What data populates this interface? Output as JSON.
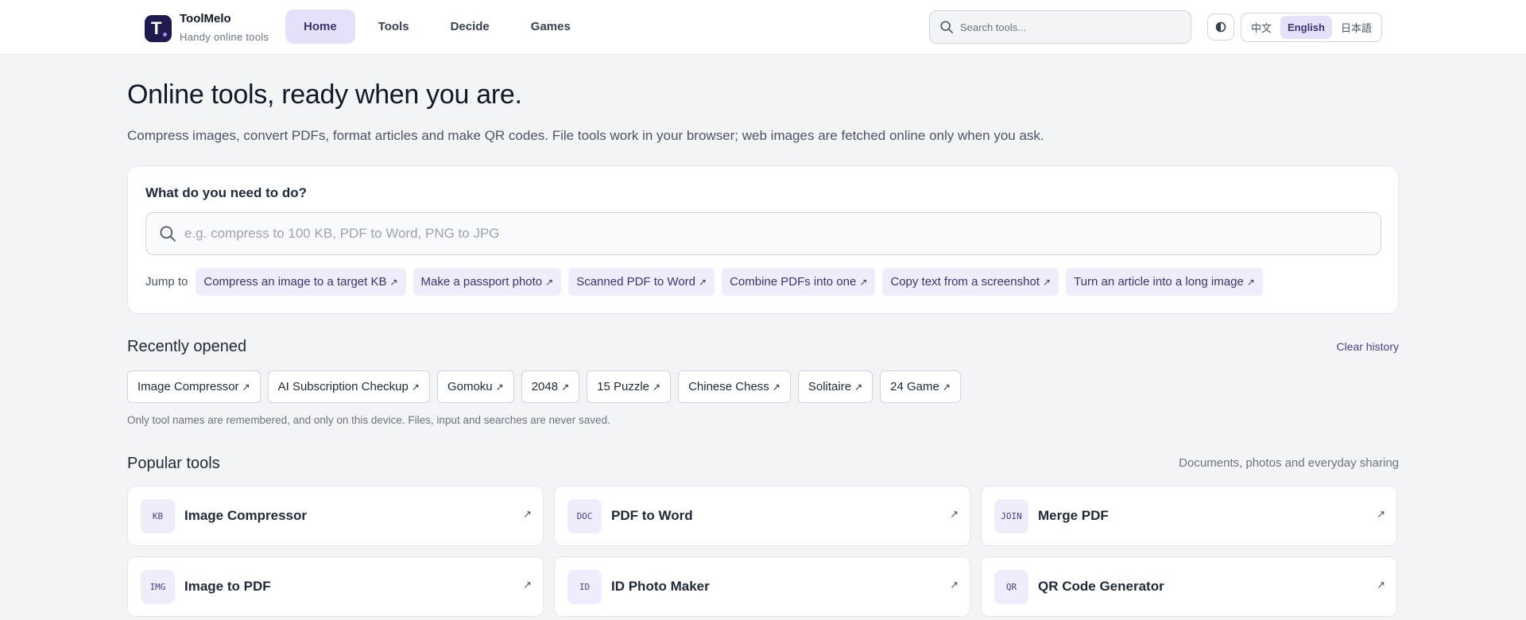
{
  "header": {
    "brand_name": "ToolMelo",
    "brand_sub": "Handy online tools",
    "logo_letter": "T",
    "nav": [
      "Home",
      "Tools",
      "Decide",
      "Games"
    ],
    "active_nav": "Home",
    "search_placeholder": "Search tools...",
    "languages": [
      "中文",
      "English",
      "日本語"
    ],
    "active_language": "English"
  },
  "hero": {
    "title": "Online tools, ready when you are.",
    "description": "Compress images, convert PDFs, format articles and make QR codes. File tools work in your browser; web images are fetched online only when you ask."
  },
  "task": {
    "title": "What do you need to do?",
    "placeholder": "e.g. compress to 100 KB, PDF to Word, PNG to JPG",
    "jump_label": "Jump to",
    "chips": [
      "Compress an image to a target KB",
      "Make a passport photo",
      "Scanned PDF to Word",
      "Combine PDFs into one",
      "Copy text from a screenshot",
      "Turn an article into a long image"
    ]
  },
  "recent": {
    "title": "Recently opened",
    "clear_label": "Clear history",
    "items": [
      "Image Compressor",
      "AI Subscription Checkup",
      "Gomoku",
      "2048",
      "15 Puzzle",
      "Chinese Chess",
      "Solitaire",
      "24 Game"
    ],
    "note": "Only tool names are remembered, and only on this device. Files, input and searches are never saved."
  },
  "popular": {
    "title": "Popular tools",
    "subtitle": "Documents, photos and everyday sharing",
    "tools": [
      {
        "badge": "KB",
        "name": "Image Compressor"
      },
      {
        "badge": "DOC",
        "name": "PDF to Word"
      },
      {
        "badge": "JOIN",
        "name": "Merge PDF"
      },
      {
        "badge": "IMG",
        "name": "Image to PDF"
      },
      {
        "badge": "ID",
        "name": "ID Photo Maker"
      },
      {
        "badge": "QR",
        "name": "QR Code Generator"
      }
    ]
  },
  "icons": {
    "arrow": "↗",
    "search": "search-icon",
    "theme": "contrast-icon"
  },
  "colors": {
    "accent": "#3b3470",
    "accent_bg": "#e4e1fb",
    "chip_bg": "#efedfb",
    "logo_bg": "#1f1b4e"
  }
}
